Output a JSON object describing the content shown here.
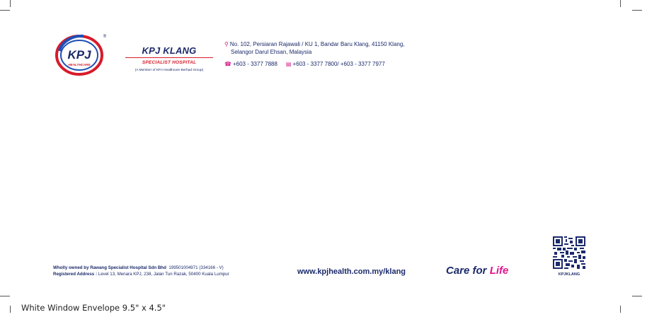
{
  "colors": {
    "navy": "#1b2a6b",
    "red": "#d81b2a",
    "magenta": "#e0148c",
    "blue": "#1f4fb5"
  },
  "logo": {
    "word": "KPJ",
    "ring_text": "HEALTHCARE",
    "registered": "®"
  },
  "brand": {
    "name": "KPJ KLANG",
    "subtitle": "SPECIALIST HOSPITAL",
    "member": "(A Member of KPJ Healthcare Berhad Group)"
  },
  "address": {
    "icon": "location-pin-icon",
    "line1": "No. 102, Persiaran Rajawali / KU 1, Bandar Baru Klang, 41150 Klang,",
    "line2": "Selangor Darul Ehsan, Malaysia"
  },
  "contact": {
    "phone_icon": "telephone-icon",
    "phone": "+603 - 3377 7888",
    "fax_icon": "fax-icon",
    "fax": "+603 - 3377 7800/ +603 - 3377 7977"
  },
  "footer": {
    "owned_label": "Wholly owned by Rawang Specialist Hospital Sdn Bhd",
    "owned_reg": "199501004971 (334166 - V)",
    "registered_label": "Registered Address :",
    "registered_value": "Level 13, Menara KPJ, 238, Jalan Tun Razak, 50400 Kuala Lumpur",
    "website": "www.kpjhealth.com.my/klang",
    "tagline_part1": "Care for ",
    "tagline_part2": "Life",
    "qr_label": "KPJKLANG"
  },
  "caption": "White Window Envelope 9.5\" x 4.5\""
}
